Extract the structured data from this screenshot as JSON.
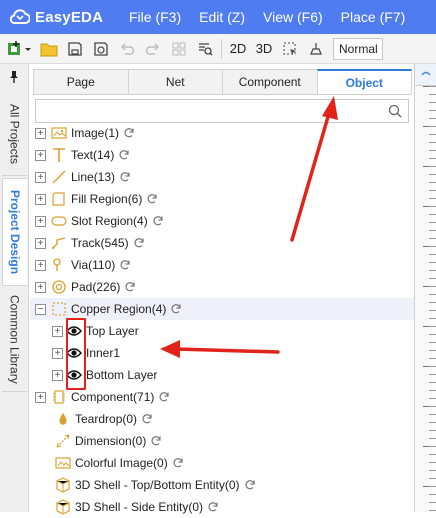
{
  "app": {
    "name": "EasyEDA"
  },
  "menu": [
    "File (F3)",
    "Edit (Z)",
    "View (F6)",
    "Place (F7)"
  ],
  "toolbar": {
    "btn_2d": "2D",
    "btn_3d": "3D",
    "mode_select": "Normal"
  },
  "left_tabs": [
    "All Projects",
    "Project Design",
    "Common Library"
  ],
  "panel_tabs": [
    "Page",
    "Net",
    "Component",
    "Object"
  ],
  "search": {
    "placeholder": "",
    "value": ""
  },
  "tree": [
    {
      "label": "Image(1)",
      "icon": "image-icon"
    },
    {
      "label": "Text(14)",
      "icon": "text-icon"
    },
    {
      "label": "Line(13)",
      "icon": "line-icon"
    },
    {
      "label": "Fill Region(6)",
      "icon": "fill-region-icon"
    },
    {
      "label": "Slot Region(4)",
      "icon": "slot-region-icon"
    },
    {
      "label": "Track(545)",
      "icon": "track-icon"
    },
    {
      "label": "Via(110)",
      "icon": "via-icon"
    },
    {
      "label": "Pad(226)",
      "icon": "pad-icon"
    },
    {
      "label": "Copper Region(4)",
      "icon": "copper-region-icon",
      "expanded": true,
      "children": [
        "Top Layer",
        "Inner1",
        "Bottom Layer"
      ]
    },
    {
      "label": "Component(71)",
      "icon": "component-icon"
    },
    {
      "label": "Teardrop(0)",
      "icon": "teardrop-icon"
    },
    {
      "label": "Dimension(0)",
      "icon": "dimension-icon"
    },
    {
      "label": "Colorful Image(0)",
      "icon": "colorful-image-icon"
    },
    {
      "label": "3D Shell - Top/Bottom Entity(0)",
      "icon": "shell-icon"
    },
    {
      "label": "3D Shell - Side Entity(0)",
      "icon": "shell-icon"
    }
  ],
  "colors": {
    "brand": "#4f7cf0",
    "accent": "#2f7bd8",
    "annotation": "#e2231a",
    "highlight_row": "#eef0fa"
  }
}
